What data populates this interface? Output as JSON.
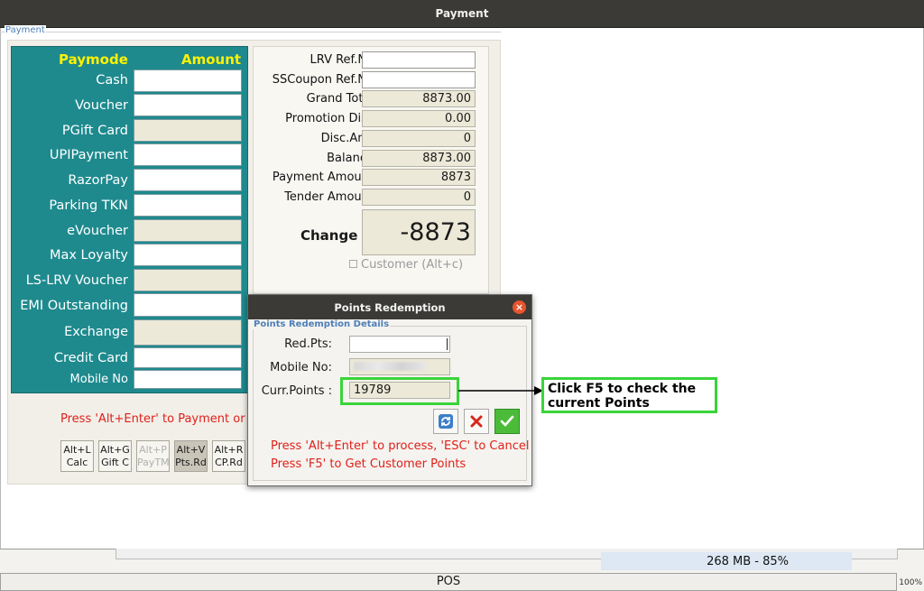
{
  "window": {
    "title": "Payment"
  },
  "group_label": "Payment",
  "paymode": {
    "header_mode": "Paymode",
    "header_amount": "Amount",
    "rows": [
      {
        "label": "Cash",
        "enabled": true
      },
      {
        "label": "Voucher",
        "enabled": true
      },
      {
        "label": "PGift Card",
        "enabled": false
      },
      {
        "label": "UPIPayment",
        "enabled": true
      },
      {
        "label": "RazorPay",
        "enabled": true
      },
      {
        "label": "Parking TKN",
        "enabled": true
      },
      {
        "label": "eVoucher",
        "enabled": false
      },
      {
        "label": "Max Loyalty",
        "enabled": true
      },
      {
        "label": "LS-LRV Voucher",
        "enabled": false
      },
      {
        "label": "EMI Outstanding",
        "enabled": true
      },
      {
        "label": "Exchange",
        "enabled": false
      },
      {
        "label": "Credit Card",
        "enabled": true
      },
      {
        "label": "Mobile No",
        "enabled": true
      }
    ]
  },
  "summary": {
    "lrv_ref_label": "LRV Ref.No",
    "lrv_ref_value": "",
    "sscoupon_label": "SSCoupon Ref.No",
    "sscoupon_value": "",
    "grand_total_label": "Grand Total",
    "grand_total": "8873.00",
    "promotion_disc_label": "Promotion Disc",
    "promotion_disc": "0.00",
    "disc_amt_label": "Disc.Amt",
    "disc_amt": "0",
    "balance_label": "Balance",
    "balance": "8873.00",
    "payment_amount_label": "Payment Amount",
    "payment_amount": "8873",
    "tender_amount_label": "Tender Amount",
    "tender_amount": "0",
    "change_label": "Change",
    "change_value": "-8873",
    "customer_checkbox": "Customer (Alt+c)"
  },
  "hint": "Press 'Alt+Enter' to Payment or '",
  "shortcuts": [
    {
      "line1": "Alt+L",
      "line2": "Calc",
      "state": "normal"
    },
    {
      "line1": "Alt+G",
      "line2": "Gift C",
      "state": "normal"
    },
    {
      "line1": "Alt+P",
      "line2": "PayTM",
      "state": "dim"
    },
    {
      "line1": "Alt+V",
      "line2": "Pts.Rd",
      "state": "pressed"
    },
    {
      "line1": "Alt+R",
      "line2": "CP.Rd",
      "state": "normal"
    }
  ],
  "dialog": {
    "title": "Points Redemption",
    "group_label": "Points Redemption Details",
    "red_pts_label": "Red.Pts:",
    "red_pts_value": "",
    "mobile_label": "Mobile No:",
    "curr_points_label": "Curr.Points :",
    "curr_points": "19789",
    "hint1": "Press 'Alt+Enter' to process, 'ESC' to Cancel",
    "hint2": "Press 'F5' to Get Customer Points"
  },
  "annotation": {
    "text": "Click F5 to check the current Points"
  },
  "status": {
    "memory": "268 MB - 85%",
    "zoom": "100%",
    "app_label": "POS"
  },
  "colors": {
    "paymode_bg": "#1e8a8e",
    "header_yellow": "#fff200",
    "hint_red": "#e0201a",
    "highlight_green": "#3ad43a",
    "titlebar": "#3b3a36"
  }
}
